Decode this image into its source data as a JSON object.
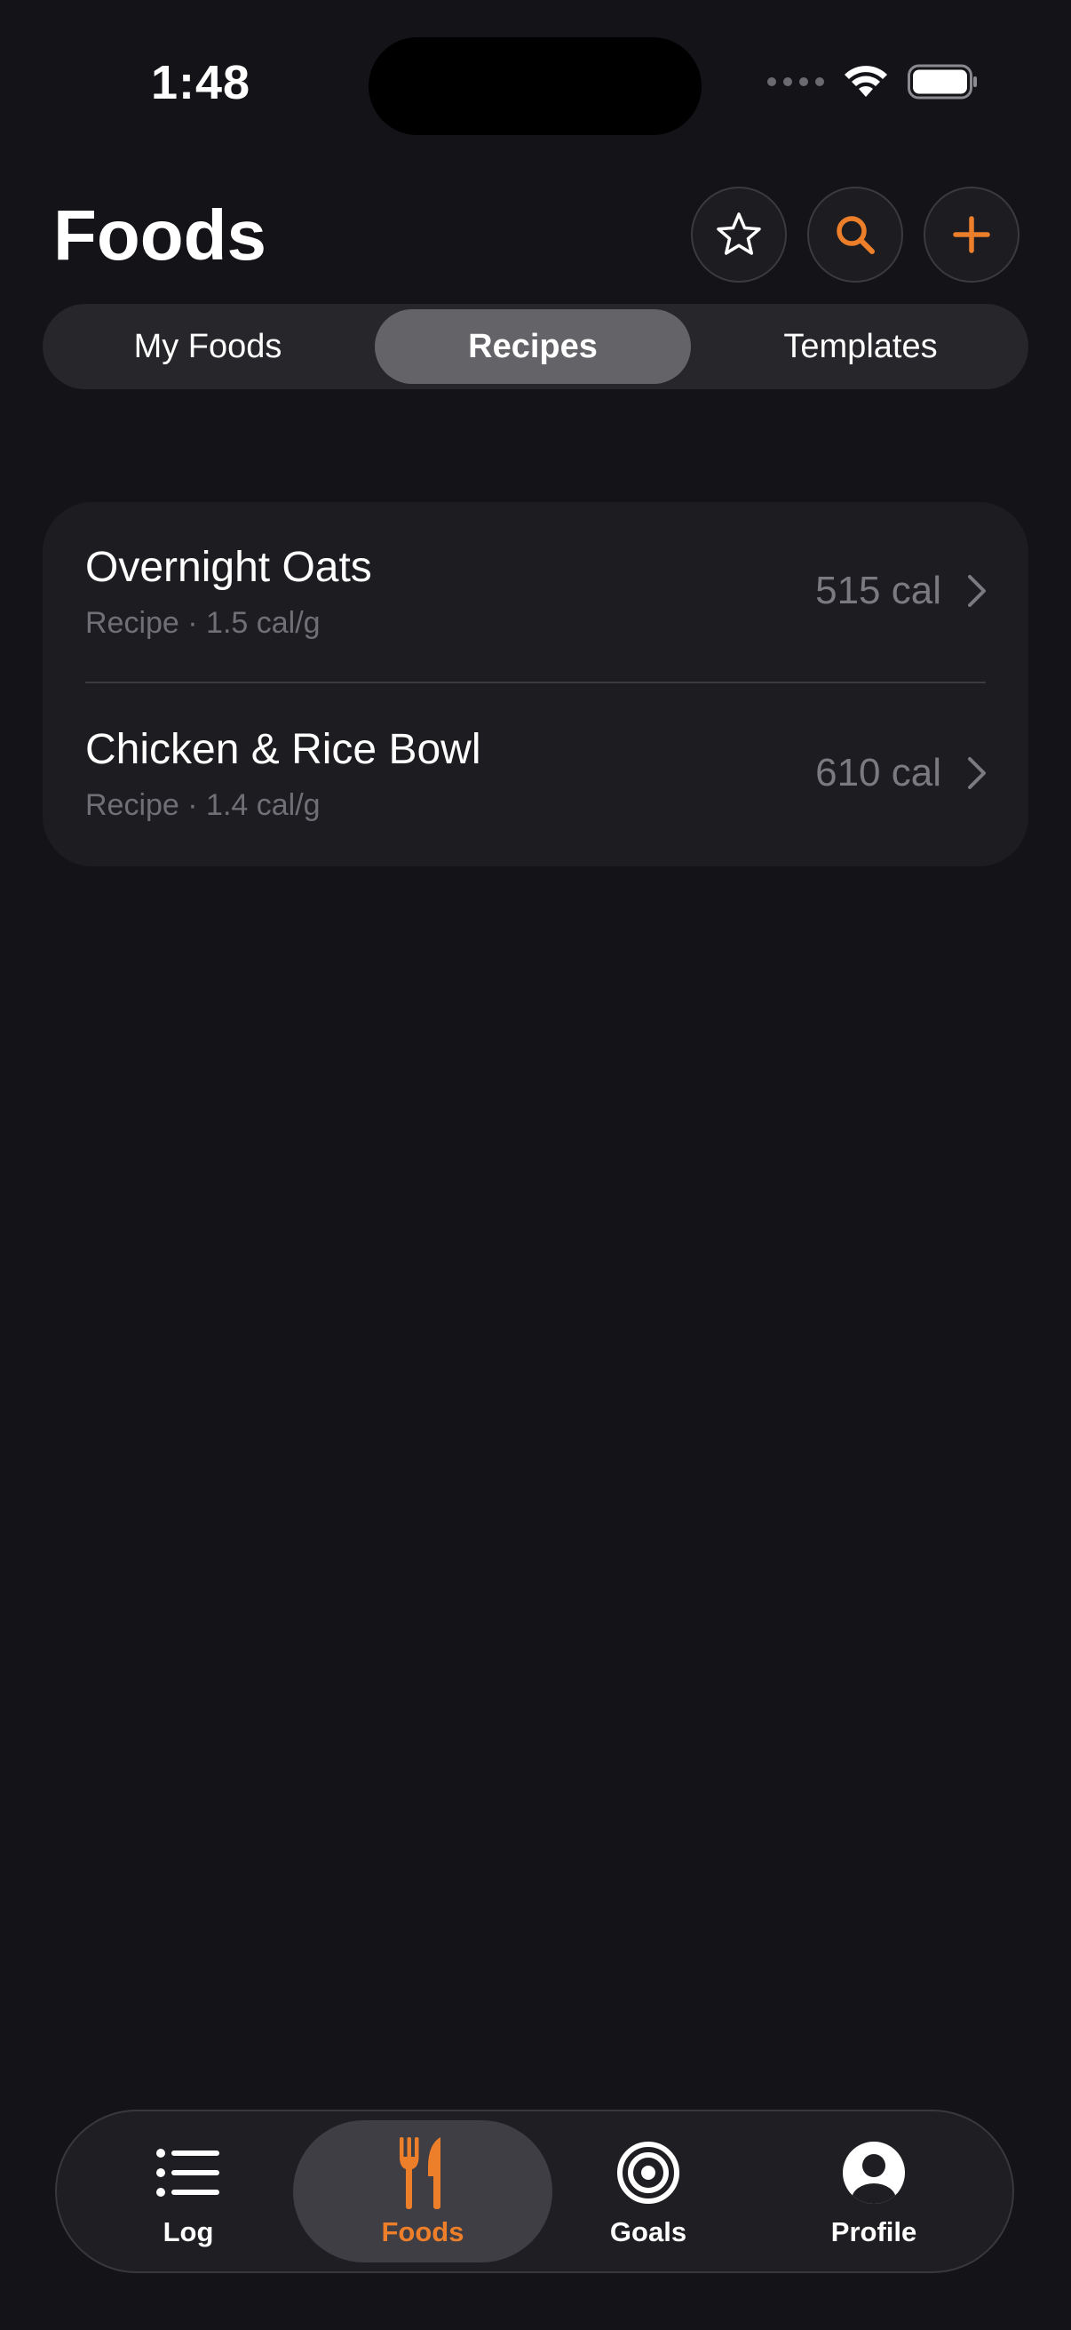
{
  "status_bar": {
    "time": "1:48"
  },
  "header": {
    "title": "Foods",
    "actions": {
      "favorites_icon": "star-icon",
      "search_icon": "search-icon",
      "add_icon": "plus-icon"
    }
  },
  "segments": {
    "items": [
      {
        "label": "My Foods",
        "selected": false
      },
      {
        "label": "Recipes",
        "selected": true
      },
      {
        "label": "Templates",
        "selected": false
      }
    ]
  },
  "recipes": {
    "rows": [
      {
        "name": "Overnight Oats",
        "meta": "Recipe · 1.5 cal/g",
        "calories": "515 cal"
      },
      {
        "name": "Chicken & Rice Bowl",
        "meta": "Recipe · 1.4 cal/g",
        "calories": "610 cal"
      }
    ]
  },
  "tab_bar": {
    "tabs": [
      {
        "label": "Log",
        "icon": "list-icon",
        "active": false
      },
      {
        "label": "Foods",
        "icon": "fork-knife-icon",
        "active": true
      },
      {
        "label": "Goals",
        "icon": "target-icon",
        "active": false
      },
      {
        "label": "Profile",
        "icon": "person-circle-icon",
        "active": false
      }
    ]
  },
  "colors": {
    "background": "#141418",
    "card": "#1d1d21",
    "accent": "#ee7f2a",
    "secondary_text": "#6f6f75"
  }
}
